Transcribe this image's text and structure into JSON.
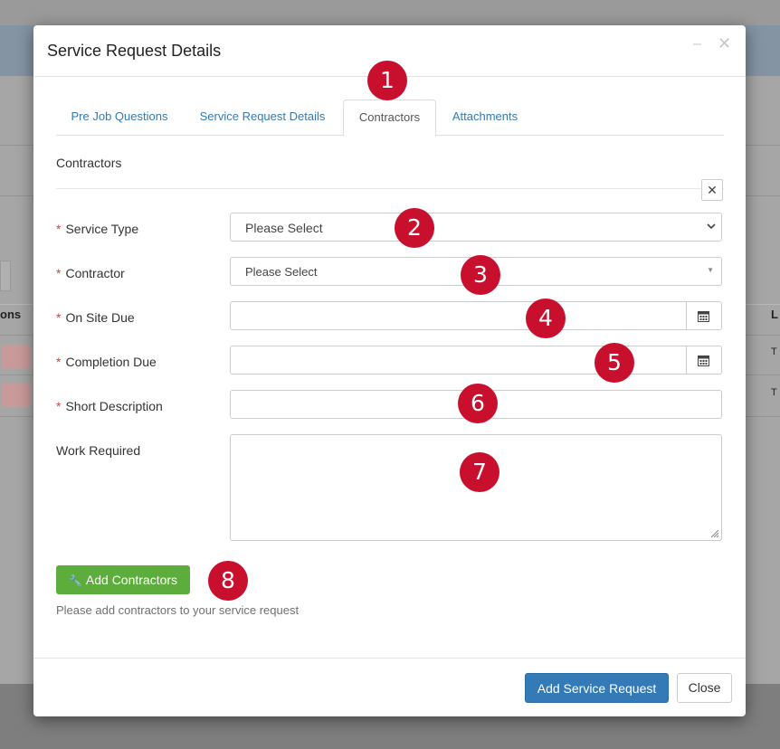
{
  "modal": {
    "title": "Service Request Details",
    "minimize_icon": "–",
    "close_icon": "✕"
  },
  "tabs": [
    {
      "label": "Pre Job Questions",
      "active": false
    },
    {
      "label": "Service Request Details",
      "active": false
    },
    {
      "label": "Contractors",
      "active": true
    },
    {
      "label": "Attachments",
      "active": false
    }
  ],
  "section": {
    "title": "Contractors",
    "remove_icon": "✕"
  },
  "form": {
    "required_mark": "*",
    "service_type": {
      "label": "Service Type",
      "value": "Please Select"
    },
    "contractor": {
      "label": "Contractor",
      "value": "Please Select"
    },
    "on_site_due": {
      "label": "On Site Due",
      "value": ""
    },
    "completion_due": {
      "label": "Completion Due",
      "value": ""
    },
    "short_description": {
      "label": "Short Description",
      "value": ""
    },
    "work_required": {
      "label": "Work Required",
      "value": ""
    }
  },
  "add_contractors": {
    "label": "Add Contractors",
    "help": "Please add contractors to your service request"
  },
  "footer": {
    "submit_label": "Add Service Request",
    "close_label": "Close"
  },
  "background": {
    "column_left": "ons",
    "column_right": "L",
    "cell_right": "T"
  },
  "markers": [
    "1",
    "2",
    "3",
    "4",
    "5",
    "6",
    "7",
    "8"
  ],
  "colors": {
    "marker": "#c8102e",
    "success_button": "#5cad3b",
    "primary_button": "#337ab7",
    "tab_link": "#337ab7",
    "required": "#b94a48"
  }
}
